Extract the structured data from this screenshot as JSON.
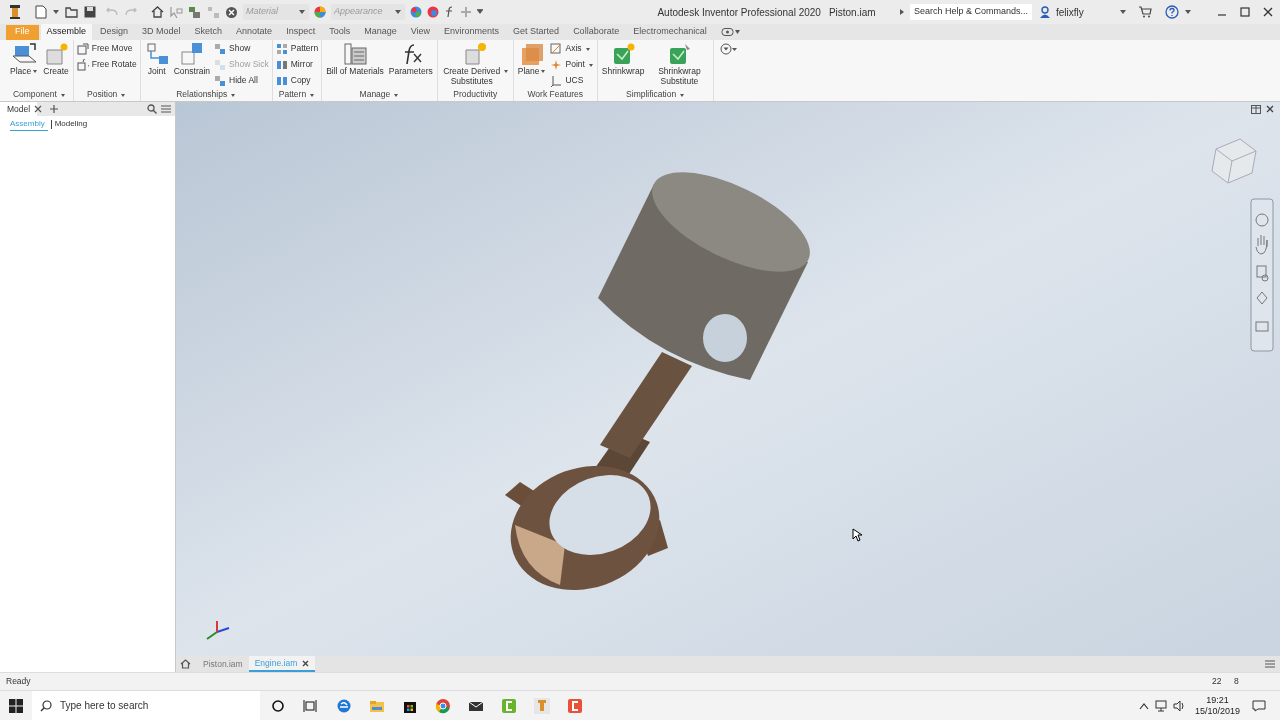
{
  "quick_access": {
    "material": "Material",
    "appearance": "Appearance"
  },
  "title_bar": {
    "app": "Autodesk Inventor Professional 2020",
    "document": "Piston.iam",
    "search_placeholder": "Search Help & Commands...",
    "user": "felixfly"
  },
  "tabs": [
    {
      "label": "File",
      "kind": "file",
      "selected": false
    },
    {
      "label": "Assemble",
      "kind": "tab",
      "selected": true
    },
    {
      "label": "Design",
      "kind": "tab",
      "selected": false
    },
    {
      "label": "3D Model",
      "kind": "tab",
      "selected": false
    },
    {
      "label": "Sketch",
      "kind": "tab",
      "selected": false
    },
    {
      "label": "Annotate",
      "kind": "tab",
      "selected": false
    },
    {
      "label": "Inspect",
      "kind": "tab",
      "selected": false
    },
    {
      "label": "Tools",
      "kind": "tab",
      "selected": false
    },
    {
      "label": "Manage",
      "kind": "tab",
      "selected": false
    },
    {
      "label": "View",
      "kind": "tab",
      "selected": false
    },
    {
      "label": "Environments",
      "kind": "tab",
      "selected": false
    },
    {
      "label": "Get Started",
      "kind": "tab",
      "selected": false
    },
    {
      "label": "Collaborate",
      "kind": "tab",
      "selected": false
    },
    {
      "label": "Electromechanical",
      "kind": "tab",
      "selected": false
    }
  ],
  "ribbon": [
    {
      "title": "Component",
      "has_menu": true,
      "groups": [
        {
          "kind": "large",
          "tools": [
            {
              "label": "Place",
              "disabled": false,
              "has_menu": true
            },
            {
              "label": "Create",
              "disabled": false,
              "has_menu": false
            }
          ]
        }
      ]
    },
    {
      "title": "Position",
      "has_menu": true,
      "groups": [
        {
          "kind": "small",
          "tools": [
            {
              "label": "Free Move",
              "disabled": false,
              "has_menu": false
            },
            {
              "label": "Free Rotate",
              "disabled": false,
              "has_menu": false
            }
          ]
        }
      ]
    },
    {
      "title": "Relationships",
      "has_menu": true,
      "groups": [
        {
          "kind": "large",
          "tools": [
            {
              "label": "Joint",
              "disabled": false,
              "has_menu": false
            },
            {
              "label": "Constrain",
              "disabled": false,
              "has_menu": false
            }
          ]
        },
        {
          "kind": "small",
          "tools": [
            {
              "label": "Show",
              "disabled": false,
              "has_menu": false
            },
            {
              "label": "Show Sick",
              "disabled": true,
              "has_menu": false
            },
            {
              "label": "Hide All",
              "disabled": false,
              "has_menu": false
            }
          ]
        }
      ]
    },
    {
      "title": "Pattern",
      "has_menu": true,
      "groups": [
        {
          "kind": "small",
          "tools": [
            {
              "label": "Pattern",
              "disabled": false,
              "has_menu": false
            },
            {
              "label": "Mirror",
              "disabled": false,
              "has_menu": false
            },
            {
              "label": "Copy",
              "disabled": false,
              "has_menu": false
            }
          ]
        }
      ]
    },
    {
      "title": "Manage",
      "has_menu": true,
      "groups": [
        {
          "kind": "large",
          "tools": [
            {
              "label": "Bill of Materials",
              "disabled": false,
              "has_menu": false
            },
            {
              "label": "Parameters",
              "disabled": false,
              "has_menu": false
            }
          ]
        }
      ]
    },
    {
      "title": "Productivity",
      "has_menu": false,
      "groups": [
        {
          "kind": "large",
          "tools": [
            {
              "label": "Create Derived Substitutes",
              "disabled": false,
              "has_menu": true
            }
          ]
        }
      ]
    },
    {
      "title": "Work Features",
      "has_menu": false,
      "groups": [
        {
          "kind": "large",
          "tools": [
            {
              "label": "Plane",
              "disabled": false,
              "has_menu": true
            }
          ]
        },
        {
          "kind": "small",
          "tools": [
            {
              "label": "Axis",
              "disabled": false,
              "has_menu": true
            },
            {
              "label": "Point",
              "disabled": false,
              "has_menu": true
            },
            {
              "label": "UCS",
              "disabled": false,
              "has_menu": false
            }
          ]
        }
      ]
    },
    {
      "title": "Simplification",
      "has_menu": true,
      "groups": [
        {
          "kind": "large",
          "tools": [
            {
              "label": "Shrinkwrap",
              "disabled": false,
              "has_menu": false
            },
            {
              "label": "Shrinkwrap Substitute",
              "disabled": false,
              "has_menu": false
            }
          ]
        }
      ]
    }
  ],
  "browser": {
    "title": "Model",
    "tabs": [
      {
        "label": "Assembly",
        "selected": true
      },
      {
        "label": "Modeling",
        "selected": false
      }
    ]
  },
  "documents": [
    {
      "label": "Piston.iam",
      "selected": false
    },
    {
      "label": "Engine.iam",
      "selected": true
    }
  ],
  "status_bar": {
    "message": "Ready",
    "field_1": "22",
    "field_2": "8"
  },
  "taskbar": {
    "search_placeholder": "Type here to search",
    "time": "19:21",
    "date": "15/10/2019"
  }
}
